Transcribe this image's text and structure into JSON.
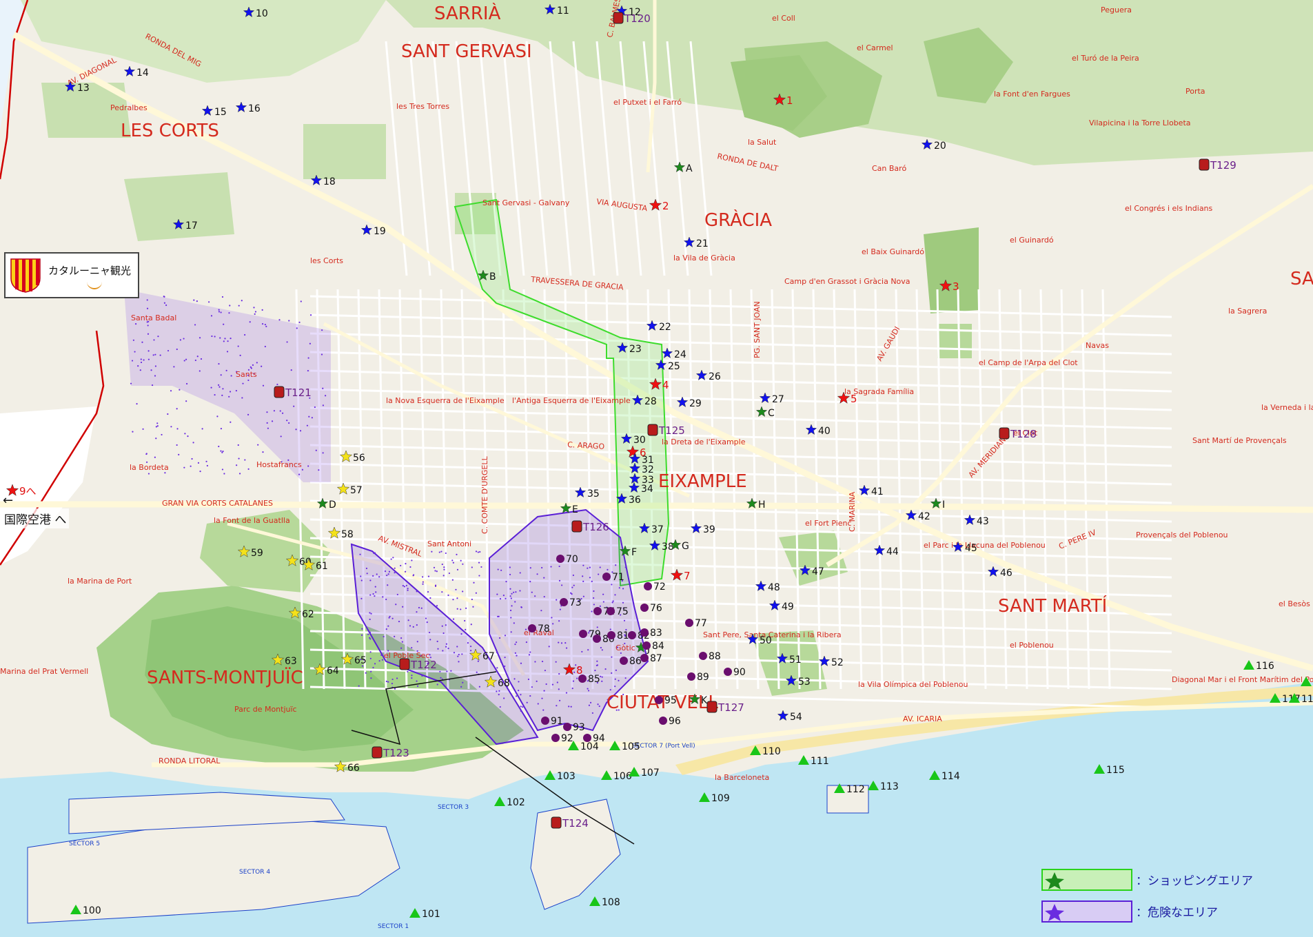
{
  "districts": [
    "SARRIÀ",
    "SANT GERVASI",
    "LES CORTS",
    "GRÀCIA",
    "EIXAMPLE",
    "SANT MARTÍ",
    "SANTS-MONTJUÏC",
    "CIUTAT VELL",
    "SA"
  ],
  "places": [
    "Pedralbes",
    "el Putxet i el Farró",
    "les Tres Torres",
    "Sant Gervasi - Galvany",
    "la Salut",
    "el Coll",
    "el Carmel",
    "Can Baró",
    "la Font d'en Fargues",
    "el Turó de la Peira",
    "Vilapicina i la Torre Llobeta",
    "Porta",
    "el Guinardó",
    "el Baix Guinardó",
    "Camp d'en Grassot i Gràcia Nova",
    "la Vila de Gràcia",
    "les Corts",
    "Santa Badal",
    "Sants",
    "la Bordeta",
    "Hostafrancs",
    "la Font de la Guatlla",
    "la Marina de Port",
    "Marina del Prat Vermell",
    "Parc de Montjuïc",
    "el Poble Sec",
    "Sant Antoni",
    "la Nova Esquerra de l'Eixample",
    "l'Antiga Esquerra de l'Eixample",
    "la Dreta de l'Eixample",
    "la Sagrada Família",
    "el Camp de l'Arpa del Clot",
    "el Clot",
    "Navas",
    "la Sagrera",
    "el Congrés i els Indians",
    "el Fort Pienc",
    "el Parc i la Llacuna del Poblenou",
    "el Poblenou",
    "Provençals del Poblenou",
    "Sant Martí de Provençals",
    "la Verneda i la Pau",
    "el Besòs i el Maresme",
    "Diagonal Mar i el Front Marítim del Poblenou",
    "la Vila Olímpica del Poblenou",
    "Sant Pere, Santa Caterina i la Ribera",
    "la Barceloneta",
    "el Raval",
    "Gòtic",
    "Peguera"
  ],
  "streets": [
    "AV. DIAGONAL",
    "RONDA DEL MIG",
    "VIA AUGUSTA",
    "TRAVESSERA DE GRACIA",
    "GRAN VIA CORTS CATALANES",
    "AV. MISTRAL",
    "C. ARAGO",
    "RONDA LITORAL",
    "AV. MERIDIANA",
    "RONDA DE DALT",
    "C. PERE IV",
    "AV. ICARIA",
    "C. MARINA",
    "C. BALMES",
    "C. COMTE D'URGELL",
    "PG. SANT JOAN",
    "AV. GAUDI"
  ],
  "markers": {
    "red_stars": [
      "1",
      "2",
      "3",
      "4",
      "5",
      "6",
      "7",
      "8",
      "9へ"
    ],
    "blue_stars": [
      "10",
      "11",
      "12",
      "13",
      "14",
      "15",
      "16",
      "17",
      "18",
      "19",
      "20",
      "21",
      "22",
      "23",
      "24",
      "25",
      "26",
      "27",
      "28",
      "29",
      "30",
      "31",
      "32",
      "33",
      "34",
      "35",
      "36",
      "37",
      "38",
      "39",
      "40",
      "41",
      "42",
      "43",
      "44",
      "45",
      "46",
      "47",
      "48",
      "49",
      "50",
      "51",
      "52",
      "53",
      "54"
    ],
    "green_stars": [
      "A",
      "B",
      "C",
      "D",
      "E",
      "F",
      "G",
      "H",
      "I",
      "J",
      "K"
    ],
    "yellow_stars": [
      "56",
      "57",
      "58",
      "59",
      "60",
      "61",
      "62",
      "63",
      "64",
      "65",
      "66",
      "67",
      "68"
    ],
    "purple_dots": [
      "70",
      "71",
      "72",
      "73",
      "74",
      "75",
      "76",
      "77",
      "78",
      "79",
      "80",
      "81",
      "82",
      "83",
      "84",
      "85",
      "86",
      "87",
      "88",
      "89",
      "90",
      "91",
      "92",
      "93",
      "94",
      "95",
      "96",
      "97"
    ],
    "green_triangles": [
      "100",
      "101",
      "102",
      "103",
      "104",
      "105",
      "106",
      "107",
      "108",
      "109",
      "110",
      "111",
      "112",
      "113",
      "114",
      "115",
      "116",
      "117",
      "118",
      "119"
    ],
    "transport": [
      "T120",
      "T121",
      "T122",
      "T123",
      "T124",
      "T125",
      "T126",
      "T127",
      "T128",
      "T129"
    ]
  },
  "logo": {
    "text": "カタルーニャ観光"
  },
  "airport": {
    "arrow": "←",
    "label": "国際空港 へ"
  },
  "legend": {
    "shopping": "：ショッピングエリア",
    "danger": "：危険なエリア"
  },
  "sectors": [
    "SECTOR 1",
    "SECTOR 3",
    "SECTOR 4",
    "SECTOR 5",
    "SECTOR 7 (Port Vell)"
  ],
  "colors": {
    "land": "#f2efe6",
    "park": "#b7d99a",
    "sea": "#bfe6f3",
    "road": "#ffffff",
    "district_text": "#d42a1e",
    "boundary": "#d00000",
    "shopping": "#3ddc2c",
    "danger": "#5a1fd6",
    "blue_star": "#1111ee",
    "red_star": "#ee1111",
    "green_star": "#1d8a1d",
    "yellow_star": "#f4e21a",
    "purple_dot": "#6a0e6e",
    "triangle": "#19c619"
  }
}
